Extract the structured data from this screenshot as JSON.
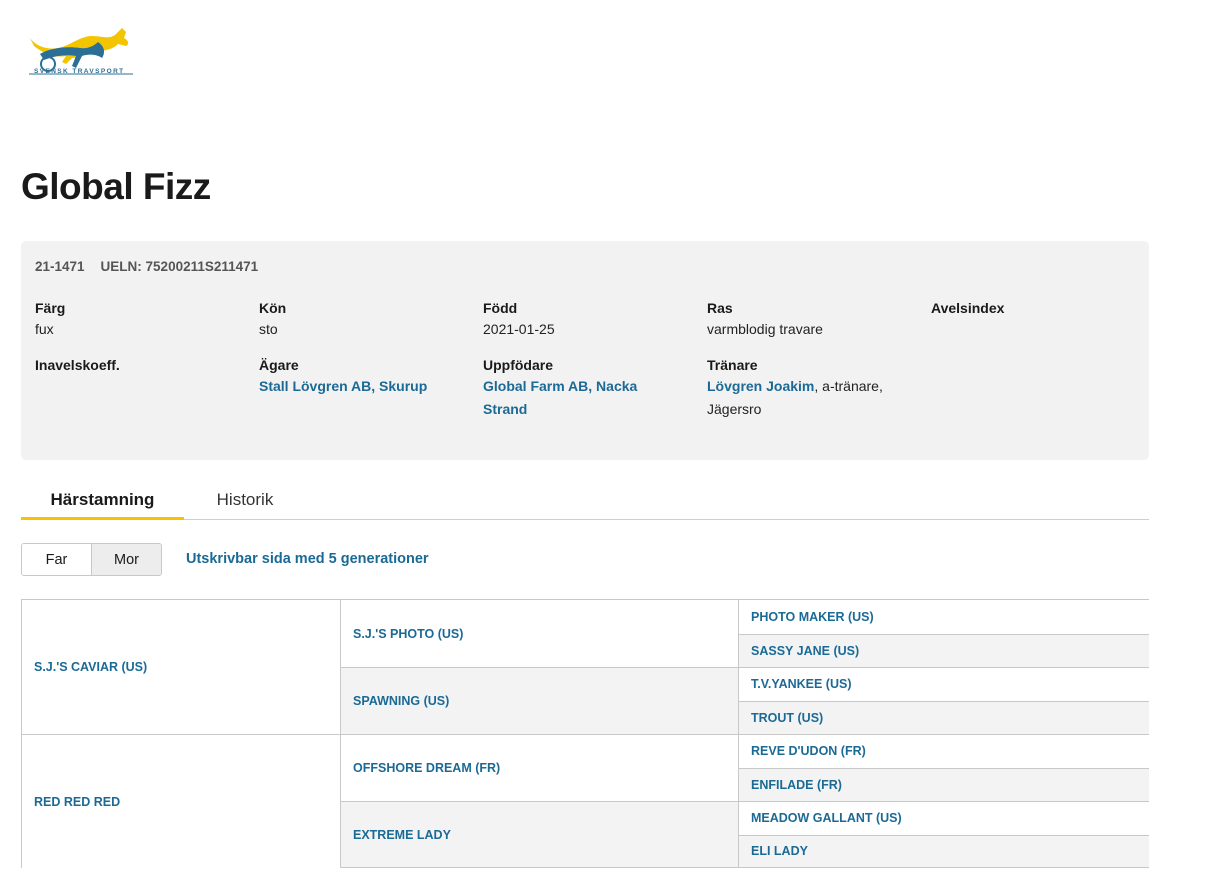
{
  "logo": {
    "text": "SVENSK TRAVSPORT",
    "icon": "horse-sulky-logo",
    "colors": {
      "yellow": "#f2c500",
      "blue": "#2b6f96"
    }
  },
  "horse": {
    "name": "Global Fizz",
    "reg_no": "21-1471",
    "ueln": "UELN: 75200211S211471"
  },
  "info": {
    "color": {
      "label": "Färg",
      "value": "fux"
    },
    "sex": {
      "label": "Kön",
      "value": "sto"
    },
    "born": {
      "label": "Född",
      "value": "2021-01-25"
    },
    "breed": {
      "label": "Ras",
      "value": "varmblodig travare"
    },
    "breeding_index": {
      "label": "Avelsindex",
      "value": ""
    },
    "inbreeding": {
      "label": "Inavelskoeff.",
      "value": ""
    },
    "owner": {
      "label": "Ägare",
      "value": "Stall Lövgren AB, Skurup"
    },
    "breeder": {
      "label": "Uppfödare",
      "value": "Global Farm AB, Nacka Strand"
    },
    "trainer": {
      "label": "Tränare",
      "name": "Lövgren Joakim",
      "suffix": ", a-tränare, Jägersro"
    }
  },
  "tabs": [
    {
      "label": "Härstamning",
      "active": true
    },
    {
      "label": "Historik",
      "active": false
    }
  ],
  "pedigree_toggle": {
    "far": "Far",
    "mor": "Mor",
    "selected": "Far"
  },
  "print_link": "Utskrivbar sida med 5 generationer",
  "pedigree": {
    "gen1": [
      "S.J.'S CAVIAR (US)",
      "RED RED RED"
    ],
    "gen2": [
      "S.J.'S PHOTO (US)",
      "SPAWNING (US)",
      "OFFSHORE DREAM (FR)",
      "EXTREME LADY"
    ],
    "gen3": [
      "PHOTO MAKER (US)",
      "SASSY JANE (US)",
      "T.V.YANKEE (US)",
      "TROUT (US)",
      "REVE D'UDON (FR)",
      "ENFILADE (FR)",
      "MEADOW GALLANT (US)",
      "ELI LADY"
    ]
  },
  "accent_colors": {
    "link": "#1b6a96",
    "tab_underline": "#f2c500",
    "panel_bg": "#f2f2f2"
  }
}
